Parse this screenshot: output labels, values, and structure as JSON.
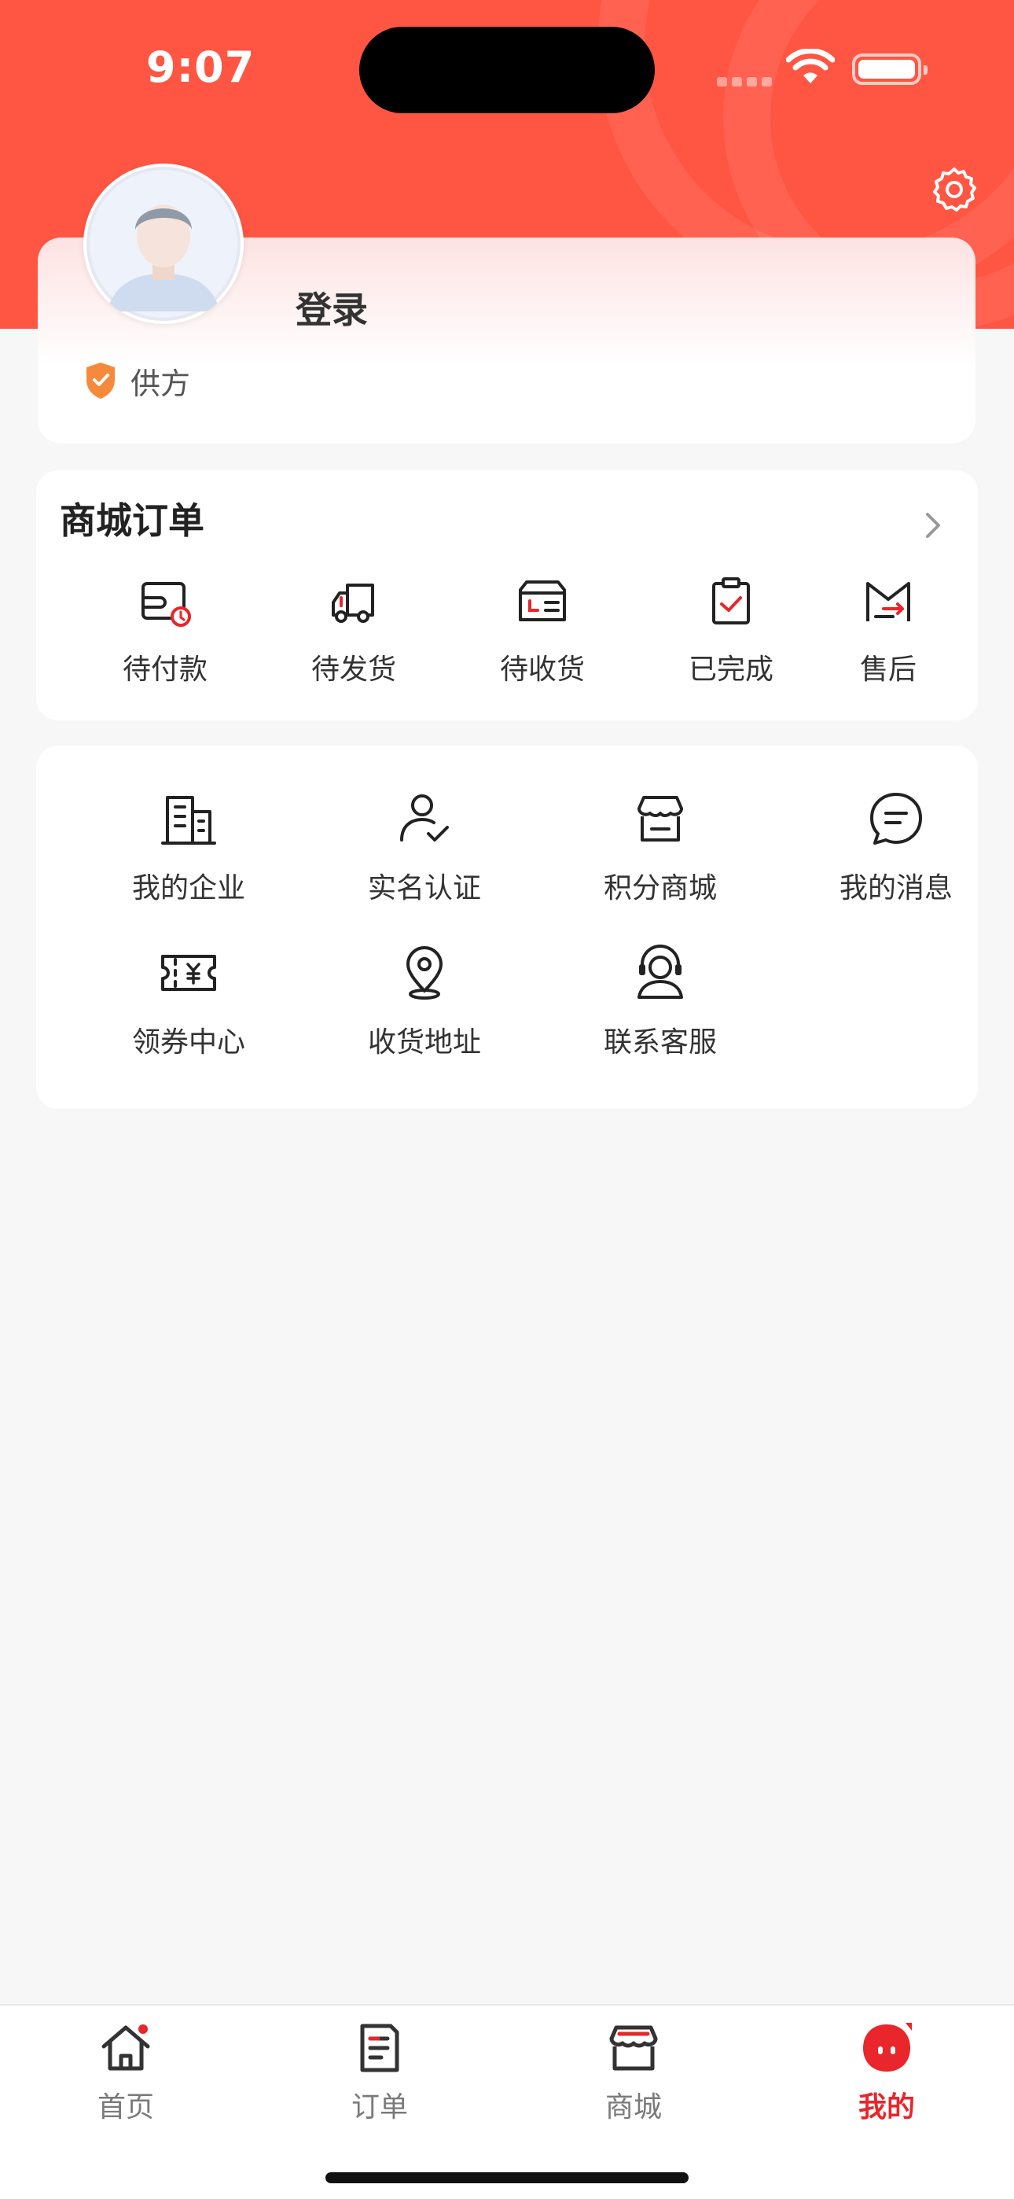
{
  "status_bar": {
    "time": "9:07"
  },
  "profile": {
    "login_label": "登录",
    "role_label": "供方"
  },
  "orders": {
    "title": "商城订单",
    "items": [
      {
        "label": "待付款",
        "icon": "wallet-clock-icon"
      },
      {
        "label": "待发货",
        "icon": "delivery-truck-icon"
      },
      {
        "label": "待收货",
        "icon": "receive-box-icon"
      },
      {
        "label": "已完成",
        "icon": "clipboard-check-icon"
      },
      {
        "label": "售后",
        "icon": "refund-exchange-icon"
      }
    ]
  },
  "tools": {
    "items": [
      {
        "label": "我的企业",
        "icon": "building-icon"
      },
      {
        "label": "实名认证",
        "icon": "user-verified-icon"
      },
      {
        "label": "积分商城",
        "icon": "store-icon"
      },
      {
        "label": "我的消息",
        "icon": "message-bubble-icon"
      },
      {
        "label": "领券中心",
        "icon": "coupon-ticket-icon"
      },
      {
        "label": "收货地址",
        "icon": "location-pin-icon"
      },
      {
        "label": "联系客服",
        "icon": "customer-service-icon"
      }
    ]
  },
  "tabbar": {
    "items": [
      {
        "label": "首页",
        "icon": "home-icon",
        "active": false
      },
      {
        "label": "订单",
        "icon": "order-doc-icon",
        "active": false
      },
      {
        "label": "商城",
        "icon": "shop-icon",
        "active": false
      },
      {
        "label": "我的",
        "icon": "profile-bubble-icon",
        "active": true
      }
    ]
  },
  "colors": {
    "brand_red": "#ff5543",
    "accent_red": "#e8262b",
    "badge_orange": "#f58a3c"
  }
}
